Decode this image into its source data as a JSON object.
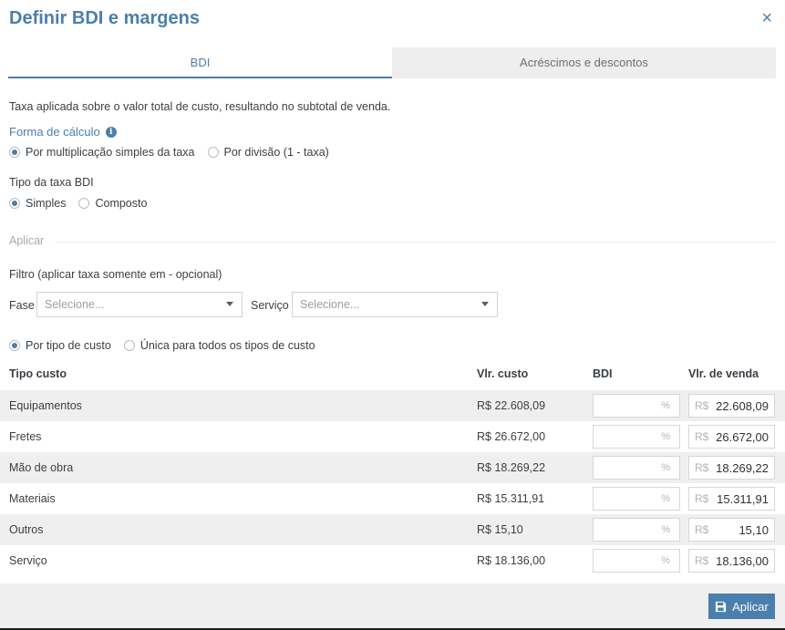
{
  "modal": {
    "title": "Definir BDI e margens",
    "close_glyph": "×"
  },
  "tabs": [
    {
      "label": "BDI",
      "active": true
    },
    {
      "label": "Acréscimos e descontos",
      "active": false
    }
  ],
  "description": "Taxa aplicada sobre o valor total de custo, resultando no subtotal de venda.",
  "forma_calculo": {
    "label": "Forma de cálculo",
    "info_glyph": "i",
    "options": [
      {
        "label": "Por multiplicação simples da taxa",
        "selected": true
      },
      {
        "label": "Por divisão (1 - taxa)",
        "selected": false
      }
    ]
  },
  "tipo_taxa": {
    "label": "Tipo da taxa BDI",
    "options": [
      {
        "label": "Simples",
        "selected": true
      },
      {
        "label": "Composto",
        "selected": false
      }
    ]
  },
  "aplicar_section": "Aplicar",
  "filtro": {
    "label": "Filtro (aplicar taxa somente em - opcional)",
    "fase_label": "Fase",
    "fase_placeholder": "Selecione...",
    "servico_label": "Serviço",
    "servico_placeholder": "Selecione..."
  },
  "modo": {
    "options": [
      {
        "label": "Por tipo de custo",
        "selected": true
      },
      {
        "label": "Única para todos os tipos de custo",
        "selected": false
      }
    ]
  },
  "table": {
    "headers": {
      "tipo": "Tipo custo",
      "vlr": "Vlr. custo",
      "bdi": "BDI",
      "venda": "Vlr. de venda"
    },
    "percent_suffix": "%",
    "currency_prefix": "R$",
    "rows": [
      {
        "tipo": "Equipamentos",
        "vlr": "R$ 22.608,09",
        "venda": "22.608,09"
      },
      {
        "tipo": "Fretes",
        "vlr": "R$ 26.672,00",
        "venda": "26.672,00"
      },
      {
        "tipo": "Mão de obra",
        "vlr": "R$ 18.269,22",
        "venda": "18.269,22"
      },
      {
        "tipo": "Materiais",
        "vlr": "R$ 15.311,91",
        "venda": "15.311,91"
      },
      {
        "tipo": "Outros",
        "vlr": "R$ 15,10",
        "venda": "15,10"
      },
      {
        "tipo": "Serviço",
        "vlr": "R$ 18.136,00",
        "venda": "18.136,00"
      }
    ]
  },
  "footer": {
    "apply_label": "Aplicar"
  },
  "colors": {
    "accent": "#4a7fad",
    "row_stripe": "#efefef"
  }
}
